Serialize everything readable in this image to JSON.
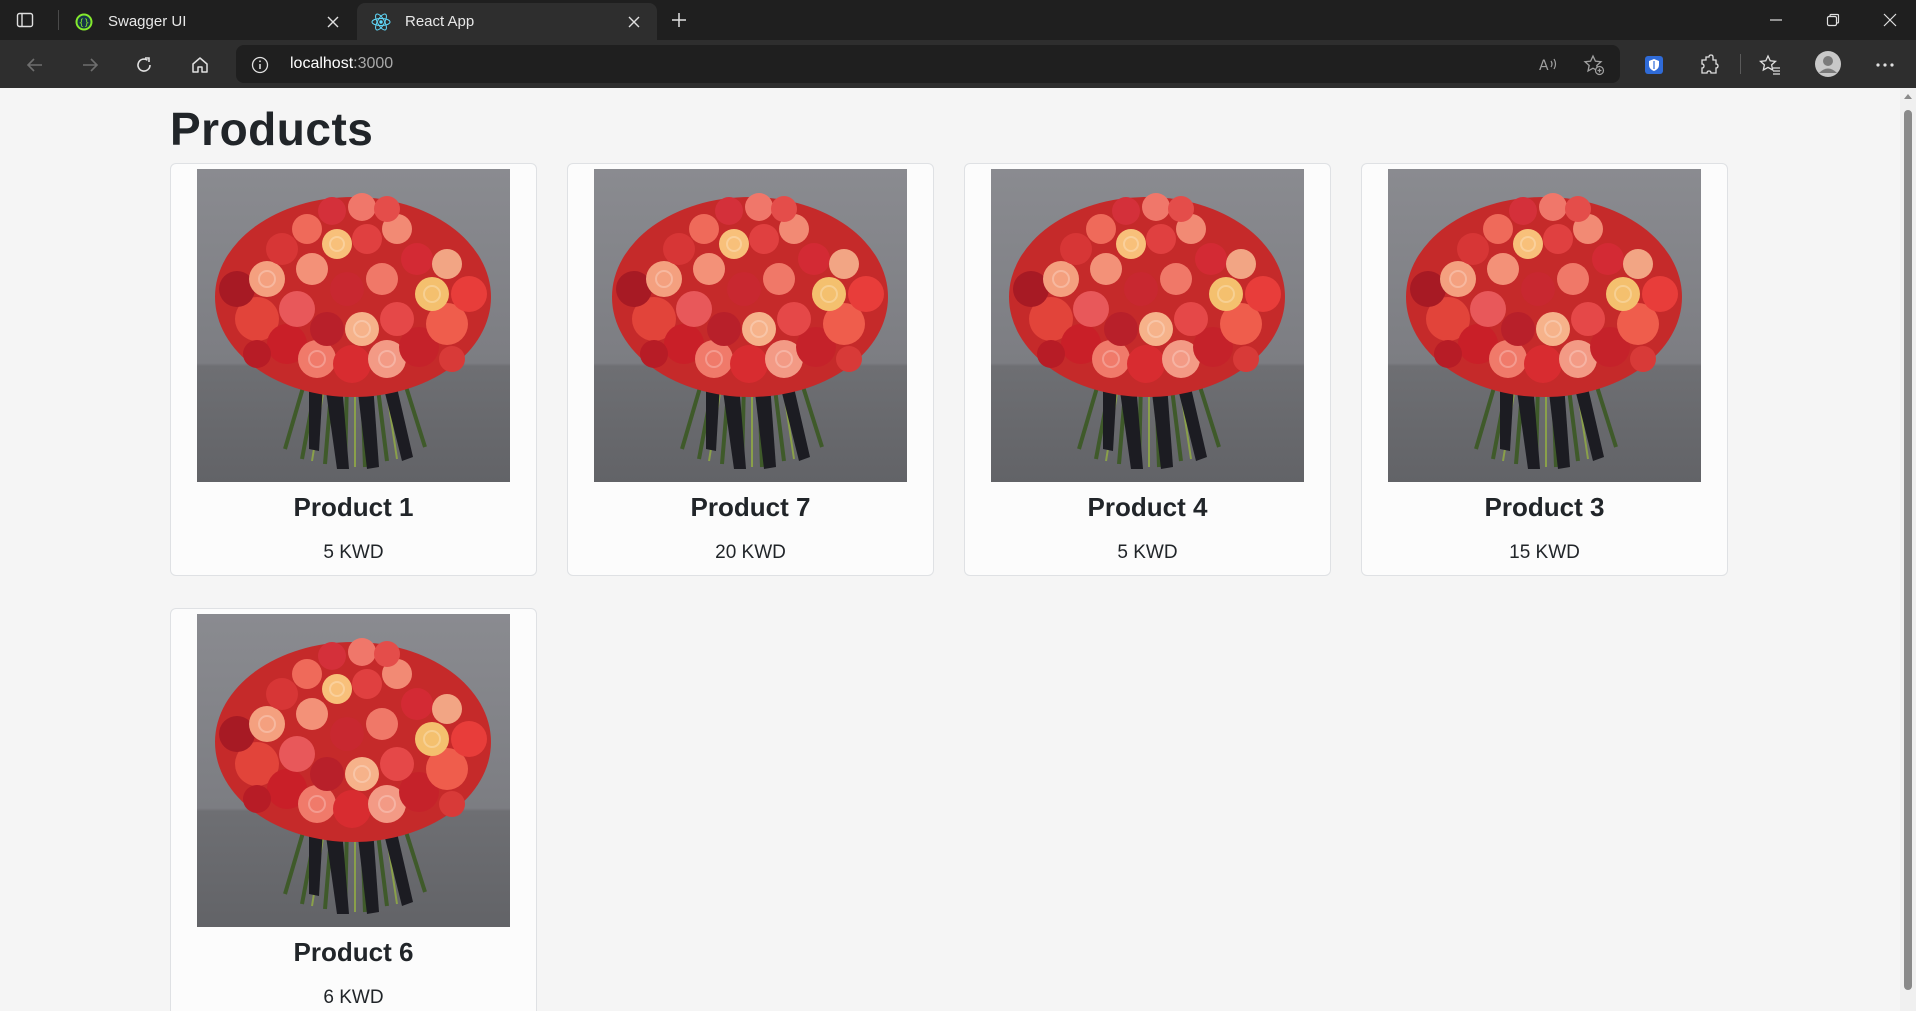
{
  "browser": {
    "tabs": [
      {
        "title": "Swagger UI",
        "favicon": "swagger-icon",
        "active": false
      },
      {
        "title": "React App",
        "favicon": "react-icon",
        "active": true
      }
    ],
    "address": {
      "host": "localhost",
      "port": ":3000"
    }
  },
  "page": {
    "title": "Products",
    "products": [
      {
        "name": "Product 1",
        "price": "5 KWD"
      },
      {
        "name": "Product 7",
        "price": "20 KWD"
      },
      {
        "name": "Product 4",
        "price": "5 KWD"
      },
      {
        "name": "Product 3",
        "price": "15 KWD"
      },
      {
        "name": "Product 6",
        "price": "6 KWD"
      }
    ]
  },
  "colors": {
    "page_background": "#f5f5f5",
    "card_background": "#fcfcfc",
    "card_border": "#dfe1e4",
    "text": "#212529",
    "chrome_dark": "#1f1f1f",
    "chrome_toolbar": "#2e2e2e"
  }
}
